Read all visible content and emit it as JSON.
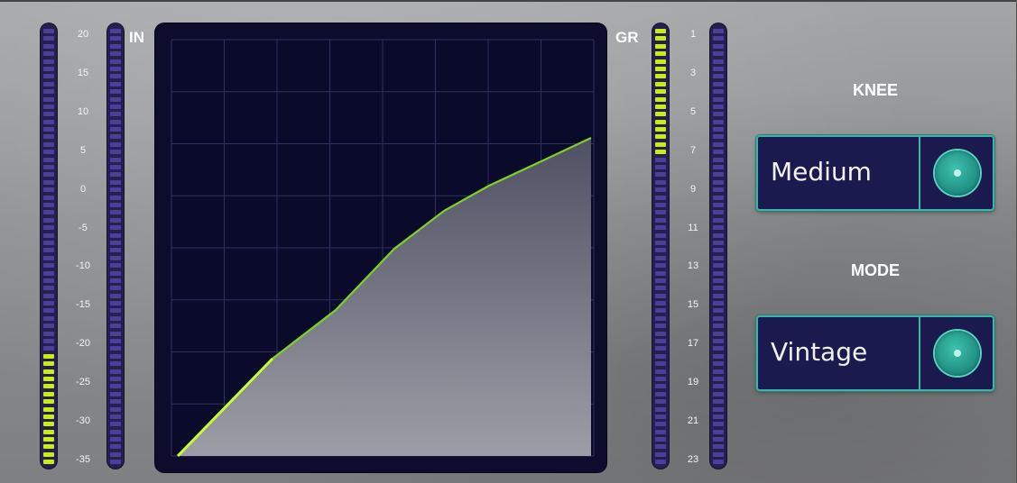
{
  "input": {
    "tag": "IN",
    "scale": [
      "20",
      "15",
      "10",
      "5",
      "0",
      "-5",
      "-10",
      "-15",
      "-20",
      "-25",
      "-30",
      "-35"
    ],
    "meter_left_level": 0.25,
    "meter_right_level": 0
  },
  "gain_reduction": {
    "tag": "GR",
    "scale": [
      "1",
      "3",
      "5",
      "7",
      "9",
      "11",
      "13",
      "15",
      "17",
      "19",
      "21",
      "23"
    ],
    "meter_left_level": 0.3,
    "meter_right_level": 0
  },
  "transfer_curve": {
    "input_db": [
      -35,
      -20,
      -12,
      -6,
      -2,
      3,
      9,
      13
    ],
    "output_db": [
      -35,
      -20,
      -12,
      -6,
      -2,
      3,
      9,
      13
    ]
  },
  "knee": {
    "label": "KNEE",
    "value": "Medium"
  },
  "mode": {
    "label": "MODE",
    "value": "Vintage"
  },
  "colors": {
    "meter_on": "#c6ee15",
    "meter_off": "#4a3f99",
    "curve": "#7ed321",
    "selector_border": "#3fb4a4"
  }
}
